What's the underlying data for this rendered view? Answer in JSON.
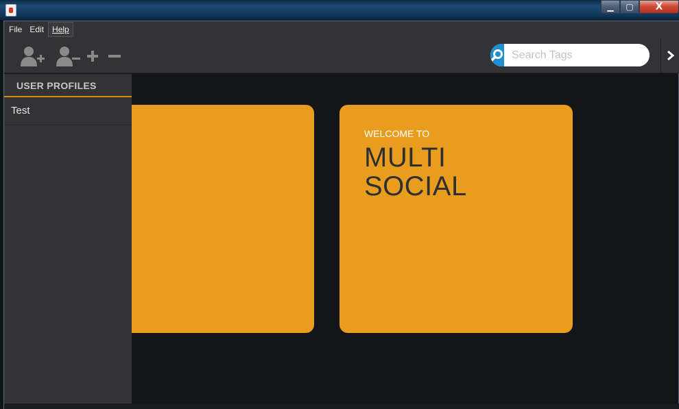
{
  "window": {
    "controls": {
      "minimize": "▁",
      "maximize": "▢",
      "close": "X"
    }
  },
  "menu": {
    "items": [
      {
        "label": "File"
      },
      {
        "label": "Edit"
      },
      {
        "label": "Help"
      }
    ]
  },
  "toolbar": {
    "icons": [
      "add-user-icon",
      "remove-user-icon",
      "plus-icon",
      "minus-icon",
      "search-icon",
      "chevron-right-icon"
    ],
    "search": {
      "placeholder": "Search Tags",
      "value": ""
    }
  },
  "sidebar": {
    "header": "USER PROFILES",
    "profiles": [
      {
        "name": "Test"
      }
    ]
  },
  "main": {
    "welcome_small": "WELCOME TO",
    "welcome_line1": "MULTI",
    "welcome_line2": "SOCIAL"
  },
  "colors": {
    "accent": "#e89d1f",
    "search_button": "#1e8fd0",
    "toolbar_bg": "#333335",
    "main_bg": "#141519",
    "title_text": "#2f2f2f"
  }
}
